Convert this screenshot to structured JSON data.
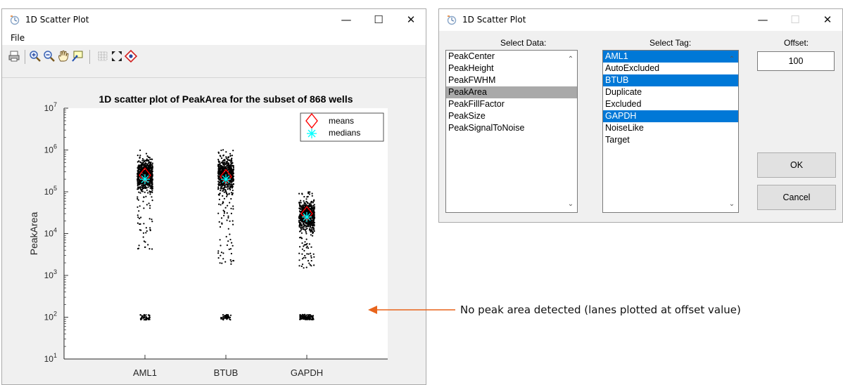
{
  "plot_window": {
    "title": "1D Scatter Plot",
    "controls": {
      "minimize": "—",
      "maximize": "☐",
      "close": "✕"
    },
    "menu": [
      "File"
    ],
    "toolbar_icons": [
      "print-icon",
      "zoom-in-icon",
      "zoom-out-icon",
      "pan-icon",
      "data-cursor-icon",
      "grid-icon",
      "fit-icon",
      "marker-icon"
    ]
  },
  "chart_data": {
    "type": "scatter",
    "title": "1D scatter plot of PeakArea for the subset of 868 wells",
    "xlabel": "",
    "ylabel": "PeakArea",
    "yscale": "log",
    "ylim": [
      10,
      10000000
    ],
    "ytick_exponents": [
      "7",
      "6",
      "5",
      "4",
      "3",
      "2",
      "1"
    ],
    "categories": [
      "AML1",
      "BTUB",
      "GAPDH"
    ],
    "legend": {
      "position": "top-right",
      "entries": [
        {
          "label": "means",
          "marker": "diamond",
          "color": "#ff0000"
        },
        {
          "label": "medians",
          "marker": "asterisk",
          "color": "#00ffff"
        }
      ]
    },
    "series": [
      {
        "name": "means",
        "values": [
          250000,
          230000,
          30000
        ]
      },
      {
        "name": "medians",
        "values": [
          200000,
          200000,
          25000
        ]
      }
    ],
    "point_clouds": [
      {
        "category": "AML1",
        "range": [
          4000,
          1000000
        ],
        "core": [
          100000,
          600000
        ],
        "offset_value": 100
      },
      {
        "category": "BTUB",
        "range": [
          1800,
          1100000
        ],
        "core": [
          100000,
          700000
        ],
        "offset_value": 100
      },
      {
        "category": "GAPDH",
        "range": [
          1500,
          100000
        ],
        "core": [
          12000,
          60000
        ],
        "offset_value": 100
      }
    ],
    "colors": {
      "points": "#000000",
      "means": "#ff0000",
      "medians": "#00ffff"
    }
  },
  "dialog": {
    "title": "1D Scatter Plot",
    "controls": {
      "minimize": "—",
      "maximize": "☐",
      "close": "✕"
    },
    "select_data_label": "Select Data:",
    "select_data_items": [
      "PeakCenter",
      "PeakHeight",
      "PeakFWHM",
      "PeakArea",
      "PeakFillFactor",
      "PeakSize",
      "PeakSignalToNoise"
    ],
    "select_data_selected": "PeakArea",
    "select_tag_label": "Select Tag:",
    "select_tag_items": [
      "AML1",
      "AutoExcluded",
      "BTUB",
      "Duplicate",
      "Excluded",
      "GAPDH",
      "NoiseLike",
      "Target"
    ],
    "select_tag_selected": [
      "AML1",
      "BTUB",
      "GAPDH"
    ],
    "offset_label": "Offset:",
    "offset_value": "100",
    "ok_label": "OK",
    "cancel_label": "Cancel"
  },
  "annotation": {
    "text": "No peak area detected (lanes plotted at offset value)",
    "arrow_color": "#e8641b"
  }
}
